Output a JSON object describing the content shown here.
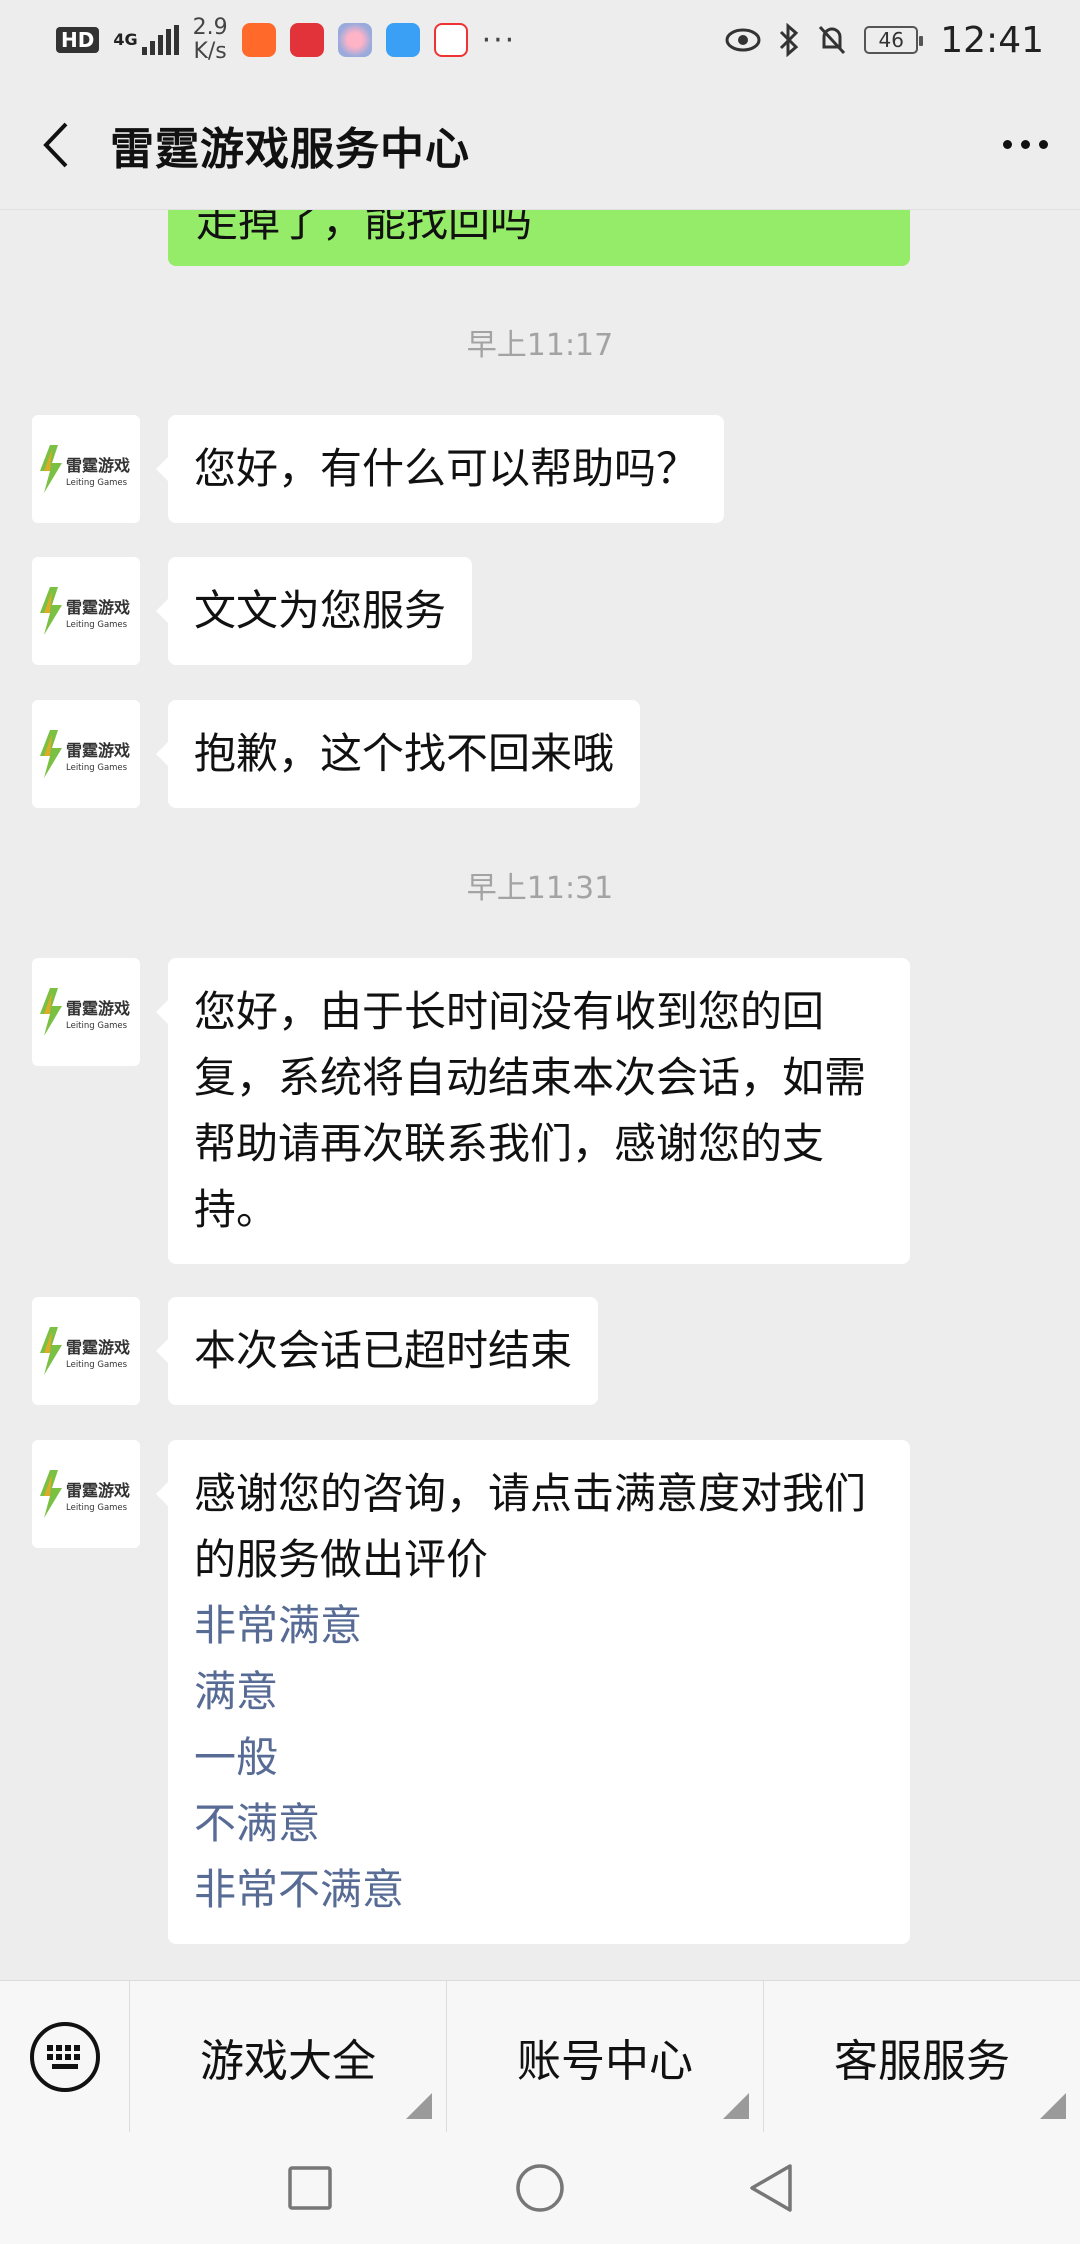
{
  "status_bar": {
    "hd": "HD",
    "network": "4G",
    "speed_value": "2.9",
    "speed_unit": "K/s",
    "more": "···",
    "battery": "46",
    "time": "12:41"
  },
  "header": {
    "title": "雷霆游戏服务中心"
  },
  "chat": {
    "partial_outgoing": "走掉了，能找回吗",
    "timestamps": [
      "早上11:17",
      "早上11:31"
    ],
    "messages": [
      {
        "text": "您好，有什么可以帮助吗？"
      },
      {
        "text": "文文为您服务"
      },
      {
        "text": "抱歉，这个找不回来哦"
      },
      {
        "text": "您好，由于长时间没有收到您的回复，系统将自动结束本次会话，如需帮助请再次联系我们，感谢您的支持。"
      },
      {
        "text": "本次会话已超时结束"
      },
      {
        "text": "感谢您的咨询，请点击满意度对我们的服务做出评价"
      }
    ],
    "rating_options": [
      "非常满意",
      "满意",
      "一般",
      "不满意",
      "非常不满意"
    ],
    "avatar": {
      "name_cn": "雷霆游戏",
      "name_en": "Leiting Games"
    }
  },
  "menu": {
    "items": [
      "游戏大全",
      "账号中心",
      "客服服务"
    ]
  },
  "colors": {
    "outgoing_bubble": "#95ec69",
    "link": "#576b95",
    "background": "#ededed"
  }
}
